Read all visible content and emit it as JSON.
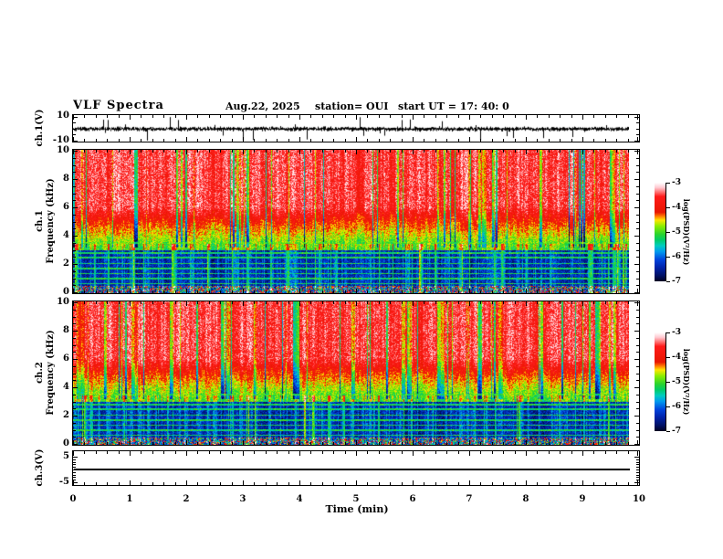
{
  "header": {
    "title": "VLF Spectra",
    "date": "Aug.22, 2025",
    "station": "station= OUI",
    "start_ut": "start UT =  17: 40: 0"
  },
  "panels": {
    "wave": {
      "ylabel": "ch.1(V)",
      "ytick_labels": [
        "10",
        "-10"
      ]
    },
    "spec1": {
      "ylabel_channel": "ch.1",
      "ylabel_freq": "Frequency (kHz)",
      "ytick_labels": [
        "10",
        "8",
        "6",
        "4",
        "2",
        "0"
      ]
    },
    "spec2": {
      "ylabel_channel": "ch.2",
      "ylabel_freq": "Frequency (kHz)",
      "ytick_labels": [
        "10",
        "8",
        "6",
        "4",
        "2",
        "0"
      ]
    },
    "ch3": {
      "ylabel": "ch.3(V)",
      "ytick_labels": [
        "5",
        "-5"
      ]
    }
  },
  "xaxis": {
    "label": "Time  (min)",
    "tick_labels": [
      "0",
      "1",
      "2",
      "3",
      "4",
      "5",
      "6",
      "7",
      "8",
      "9",
      "10"
    ]
  },
  "colorbar": {
    "label": "log(PSD)(V²/Hz)",
    "tick_labels": [
      "-3",
      "-4",
      "-5",
      "-6",
      "-7"
    ]
  },
  "colors": {
    "background": "#ffffff",
    "foreground": "#000000",
    "trace": "#000000"
  },
  "colormap": {
    "value_range": [
      -7,
      -3
    ],
    "stops": [
      [
        0.0,
        "#ffffff"
      ],
      [
        0.05,
        "#ffc8d0"
      ],
      [
        0.1,
        "#ff6a6a"
      ],
      [
        0.14,
        "#ff1a1a"
      ],
      [
        0.3,
        "#e81800"
      ],
      [
        0.34,
        "#ff7a00"
      ],
      [
        0.38,
        "#ffe400"
      ],
      [
        0.44,
        "#8cee00"
      ],
      [
        0.52,
        "#2cd42c"
      ],
      [
        0.58,
        "#00cc66"
      ],
      [
        0.64,
        "#00ccc0"
      ],
      [
        0.7,
        "#0099ee"
      ],
      [
        0.78,
        "#0044dd"
      ],
      [
        0.86,
        "#0022aa"
      ],
      [
        0.94,
        "#001166"
      ],
      [
        1.0,
        "#000022"
      ]
    ]
  },
  "chart_data": [
    {
      "type": "line",
      "name": "ch1_waveform",
      "ylabel": "ch.1(V)",
      "x_range_min": [
        0,
        10
      ],
      "y_ticks_V": [
        10,
        -10
      ],
      "data_end_min": 9.83,
      "noise_sigma_V": 1.5,
      "spike_max_V": 10,
      "deep_spike_positions_min": [
        1.3,
        3.0,
        7.2
      ],
      "seed": 42,
      "description": "Dense broadband noise trace ~±2 V about 0 with frequent impulsive spikes reaching ±10 V"
    },
    {
      "type": "heatmap",
      "name": "ch1_spectrogram",
      "ylabel": "ch.1 Frequency (kHz)",
      "x_range_min": [
        0,
        10
      ],
      "y_range_kHz": [
        0,
        10
      ],
      "y_ticks_kHz": [
        0,
        2,
        4,
        6,
        8,
        10
      ],
      "value_units": "log(PSD)(V²/Hz)",
      "value_range": [
        -7,
        -3
      ],
      "data_end_min": 9.83,
      "bands": [
        {
          "f_khz": [
            6,
            10
          ],
          "level": -3.55
        },
        {
          "f_khz": [
            4,
            6
          ],
          "level_range": [
            -4.65,
            -3.55
          ]
        },
        {
          "f_khz": [
            3,
            4
          ],
          "level_range": [
            -5.15,
            -4.65
          ]
        },
        {
          "f_khz": [
            0.45,
            3
          ],
          "level": -6.45
        }
      ],
      "horizontal_lines_khz": [
        0.65,
        1.0,
        1.35,
        1.7,
        2.05,
        2.45,
        2.8,
        3.15,
        3.5
      ],
      "seed": 7,
      "description": "Red/orange PSD above ~5 kHz with vertical yellow-green streaks, green 3-5 kHz, dark blue below 3 kHz crossed by green power-line harmonic lines and dense cyan sferic streaks; mixed impulsive noise in bottom band"
    },
    {
      "type": "heatmap",
      "name": "ch2_spectrogram",
      "ylabel": "ch.2 Frequency (kHz)",
      "x_range_min": [
        0,
        10
      ],
      "y_range_kHz": [
        0,
        10
      ],
      "y_ticks_kHz": [
        0,
        2,
        4,
        6,
        8,
        10
      ],
      "value_units": "log(PSD)(V²/Hz)",
      "value_range": [
        -7,
        -3
      ],
      "data_end_min": 9.83,
      "bands": [
        {
          "f_khz": [
            6,
            10
          ],
          "level": -3.55
        },
        {
          "f_khz": [
            4,
            6
          ],
          "level_range": [
            -4.65,
            -3.55
          ]
        },
        {
          "f_khz": [
            3,
            4
          ],
          "level_range": [
            -5.15,
            -4.65
          ]
        },
        {
          "f_khz": [
            0.45,
            3
          ],
          "level": -6.45
        }
      ],
      "horizontal_lines_khz": [
        0.65,
        1.0,
        1.35,
        1.7,
        2.05,
        2.45,
        2.8,
        3.15,
        3.5
      ],
      "seed": 19,
      "description": "Same structure as ch.1 spectrogram"
    },
    {
      "type": "line",
      "name": "ch3_flat",
      "ylabel": "ch.3(V)",
      "x_range_min": [
        0,
        10
      ],
      "y_ticks_V": [
        5,
        -5
      ],
      "data_end_min": 9.83,
      "constant_value_V": 0,
      "description": "Flat line at 0 V from 0 to 9.83 min"
    }
  ]
}
